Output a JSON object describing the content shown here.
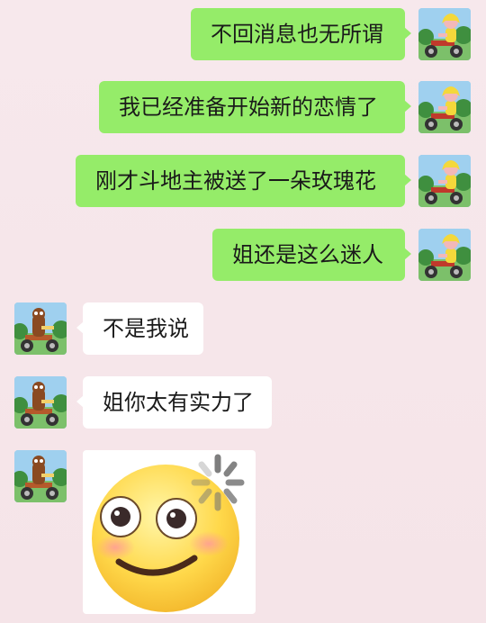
{
  "messages": [
    {
      "side": "right",
      "text": "不回消息也无所谓"
    },
    {
      "side": "right",
      "text": "我已经准备开始新的恋情了"
    },
    {
      "side": "right",
      "text": "刚才斗地主被送了一朵玫瑰花"
    },
    {
      "side": "right",
      "text": "姐还是这么迷人"
    },
    {
      "side": "left",
      "text": "不是我说"
    },
    {
      "side": "left",
      "text": "姐你太有实力了"
    }
  ],
  "sticker": {
    "icon": "loading-smiley-emoji-icon"
  },
  "colors": {
    "outgoing_bubble": "#95ec69",
    "incoming_bubble": "#ffffff",
    "background": "#f7e8ec"
  },
  "icons": {
    "right_avatar": "cartoon-girl-on-tricycle-avatar-icon",
    "left_avatar": "cartoon-boy-on-tricycle-avatar-icon"
  }
}
